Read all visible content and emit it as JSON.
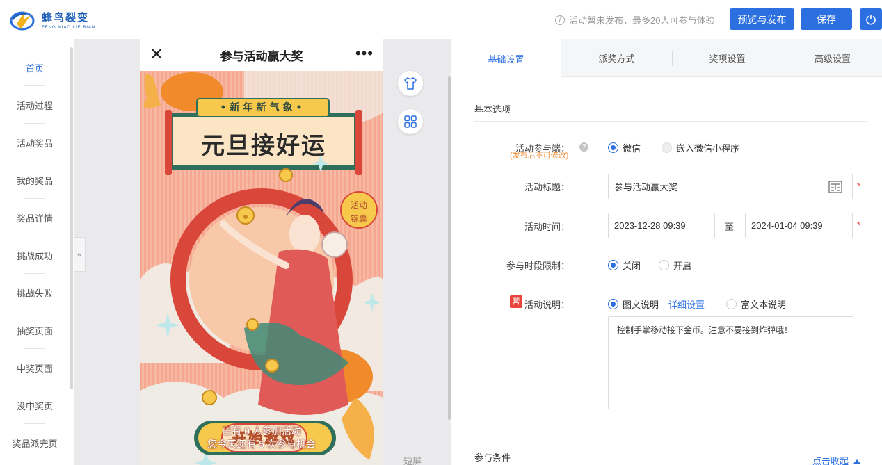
{
  "brand": {
    "name_cn": "蜂鸟裂变",
    "name_en": "FENG NIAO LIE BIAN"
  },
  "header": {
    "notice": "活动暂未发布，最多20人可参与体验",
    "preview_publish": "预览与发布",
    "save": "保存"
  },
  "sidebar": {
    "items": [
      {
        "label": "首页"
      },
      {
        "label": "活动过程"
      },
      {
        "label": "活动奖品"
      },
      {
        "label": "我的奖品"
      },
      {
        "label": "奖品详情"
      },
      {
        "label": "挑战成功"
      },
      {
        "label": "挑战失败"
      },
      {
        "label": "抽奖页面"
      },
      {
        "label": "中奖页面"
      },
      {
        "label": "没中奖页"
      },
      {
        "label": "奖品派完页"
      }
    ]
  },
  "canvas": {
    "collapse": "«",
    "short_screen": "短屏"
  },
  "phone": {
    "title": "参与活动赢大奖",
    "close": "✕",
    "more": "•••",
    "poster": {
      "banner_top": "•新年新气象•",
      "banner_main": "元旦接好运",
      "badge_top": "活动",
      "badge_bottom": "锦囊",
      "start_button": "开始游戏",
      "joined_text": "已有 0 人参加活动",
      "remaining_text": "您今天还有 5 次参与机会"
    }
  },
  "panel": {
    "tabs": [
      {
        "label": "基础设置"
      },
      {
        "label": "派奖方式"
      },
      {
        "label": "奖项设置"
      },
      {
        "label": "高级设置"
      }
    ],
    "section_title": "基本选项",
    "platform": {
      "label": "活动参与端：",
      "note": "(发布后不可修改)",
      "help": "?",
      "options": [
        "微信",
        "嵌入微信小程序"
      ]
    },
    "title_field": {
      "label": "活动标题：",
      "value": "参与活动赢大奖"
    },
    "time_field": {
      "label": "活动时间：",
      "start": "2023-12-28 09:39",
      "sep": "至",
      "end": "2024-01-04 09:39"
    },
    "period_limit": {
      "label": "参与时段限制：",
      "options": [
        "关闭",
        "开启"
      ]
    },
    "description": {
      "badge": "营",
      "label": "活动说明：",
      "options": [
        "图文说明",
        "富文本说明"
      ],
      "detail_link": "详细设置",
      "text": "控制手掌移动接下金币。注意不要接到炸弹哦！"
    },
    "required_mark": "*",
    "conditions_title": "参与条件",
    "fold": "点击收起"
  },
  "colors": {
    "accent": "#2b6fe0",
    "danger": "#e8463a",
    "warning": "#f0903a"
  }
}
